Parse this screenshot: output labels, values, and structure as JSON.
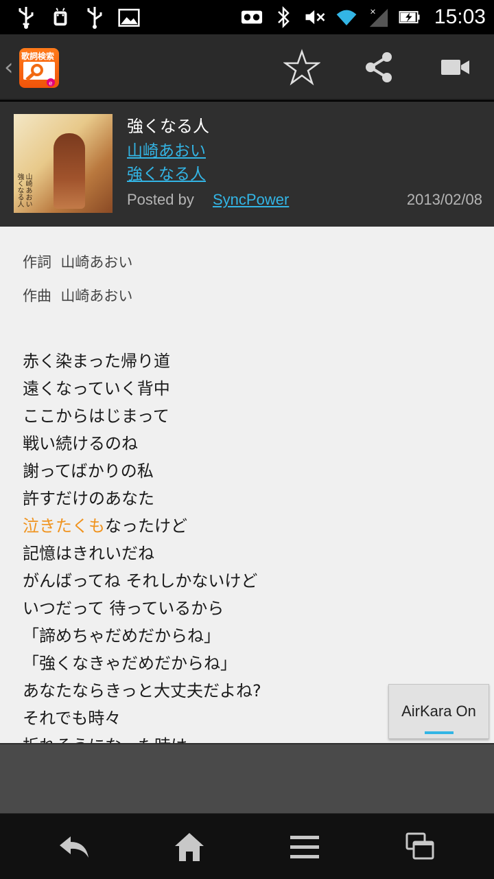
{
  "status_bar": {
    "time": "15:03",
    "left_icons": [
      "usb-icon",
      "android-debug-icon",
      "usb-icon",
      "image-notification-icon"
    ],
    "right_icons": [
      "voicemail-icon",
      "bluetooth-icon",
      "mute-icon",
      "wifi-icon",
      "no-signal-icon",
      "battery-charging-icon"
    ]
  },
  "action_bar": {
    "logo_text": "歌詞検索",
    "buttons": [
      "star-icon",
      "share-icon",
      "video-icon"
    ]
  },
  "song": {
    "title": "強くなる人",
    "artist": "山崎あおい",
    "album": "強くなる人",
    "posted_by_label": "Posted by",
    "poster": "SyncPower",
    "date": "2013/02/08",
    "cover_text": "山崎あおい 強くなる人"
  },
  "credits": {
    "lyricist_label": "作詞",
    "lyricist": "山崎あおい",
    "composer_label": "作曲",
    "composer": "山崎あおい"
  },
  "lyrics": {
    "lines": [
      "赤く染まった帰り道",
      "遠くなっていく背中",
      "ここからはじまって",
      "戦い続けるのね",
      "謝ってばかりの私",
      "許すだけのあなた",
      "",
      "記憶はきれいだね",
      "がんばってね それしかないけど",
      "いつだって 待っているから",
      "「諦めちゃだめだからね」",
      "「強くなきゃだめだからね」",
      "あなたならきっと大丈夫だよね?",
      "それでも時々",
      "折れそうになった時は"
    ],
    "highlight_line": {
      "sung": "泣きたくも",
      "rest": "なったけど"
    }
  },
  "airkara_button": "AirKara On",
  "colors": {
    "accent_blue": "#33b5e5",
    "highlight_orange": "#f0931e",
    "logo_orange": "#f26a12"
  },
  "nav_bar": [
    "back-icon",
    "home-icon",
    "menu-icon",
    "recent-apps-icon"
  ]
}
